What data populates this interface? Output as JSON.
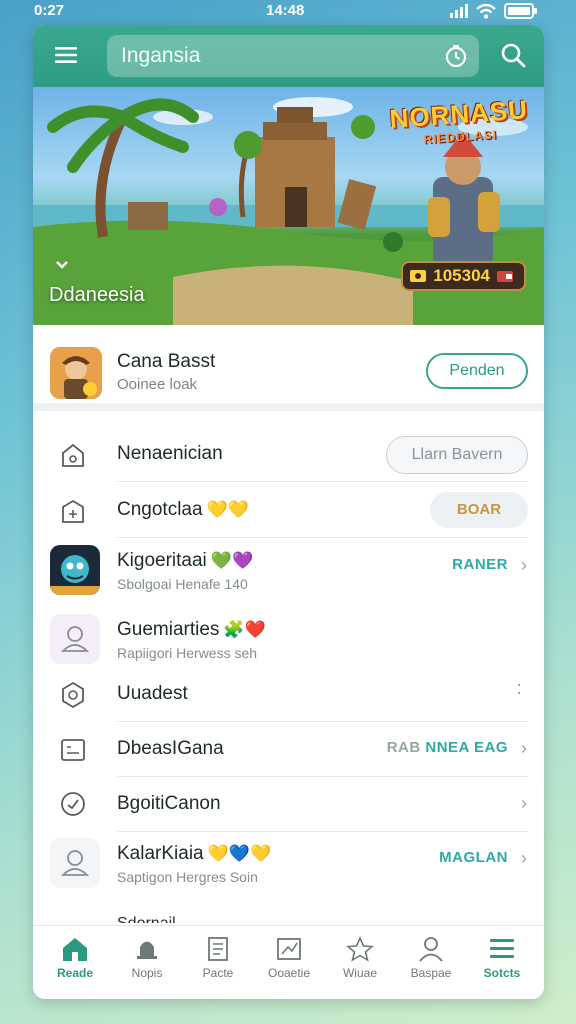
{
  "status_bar": {
    "time_left": "0:27",
    "time_center": "14:48"
  },
  "header": {
    "search_value": "Ingansia"
  },
  "banner": {
    "title": "Ddaneesia",
    "brand": "NORNASU",
    "brand_sub": "RIEDDLASI",
    "coins": "105304"
  },
  "featured": {
    "title": "Cana Basst",
    "subtitle": "Ooinee loak",
    "button": "Penden"
  },
  "list": {
    "items": [
      {
        "title": "Nenaenician",
        "action": "Llarn Bavern"
      },
      {
        "title": "Cngotclaa",
        "emoji": "💛💛",
        "action": "BOAR"
      },
      {
        "title": "Kigoeritaai",
        "emoji": "💚💜",
        "subtitle": "Sbolgoai Henafe 140",
        "link": "RANER"
      },
      {
        "title": "Guemiarties",
        "emoji": "🧩❤️",
        "subtitle": "Rapiigori Herwess seh"
      },
      {
        "title": "Uuadest"
      },
      {
        "title": "DbeasIGana",
        "link_gray": "RAB",
        "link_teal": "NNEA EAG"
      },
      {
        "title": "BgoitiCanon"
      },
      {
        "title": "KalarKiaia",
        "emoji": "💛💙💛",
        "subtitle": "Saptigon Hergres Soin",
        "link": "MAGLAN"
      }
    ],
    "peek_title": "Sdornail"
  },
  "tabs": [
    {
      "label": "Reade",
      "icon": "home-icon",
      "active": true
    },
    {
      "label": "Nopis",
      "icon": "bell-icon",
      "active": false
    },
    {
      "label": "Pacte",
      "icon": "document-icon",
      "active": false
    },
    {
      "label": "Ooaetie",
      "icon": "chart-icon",
      "active": false
    },
    {
      "label": "Wiuae",
      "icon": "star-icon",
      "active": false
    },
    {
      "label": "Baspae",
      "icon": "person-icon",
      "active": false
    },
    {
      "label": "Sotcts",
      "icon": "menu-icon",
      "active": true
    }
  ],
  "colors": {
    "accent": "#2f9c84",
    "teal_text": "#2fa9a6"
  }
}
